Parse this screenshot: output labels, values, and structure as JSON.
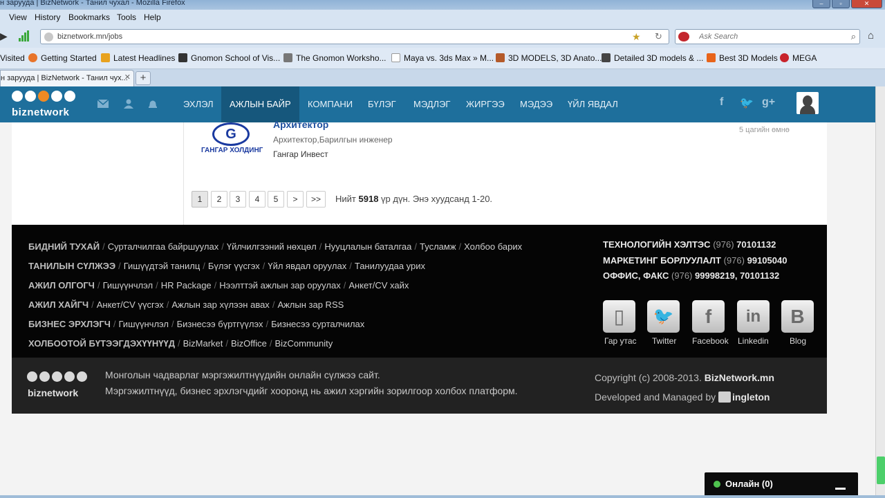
{
  "browser": {
    "window_title": "н заруудa | BizNetwork - Танил чухал - Mozilla Firefox",
    "menu": [
      "View",
      "History",
      "Bookmarks",
      "Tools",
      "Help"
    ],
    "url": "biznetwork.mn/jobs",
    "search_placeholder": "Ask Search",
    "bookmarks": [
      {
        "label": "Visited",
        "color": "#ffffff"
      },
      {
        "label": "Getting Started",
        "color": "#e8742a"
      },
      {
        "label": "Latest Headlines",
        "color": "#e8a21f"
      },
      {
        "label": "Gnomon School of Vis...",
        "color": "#333333"
      },
      {
        "label": "The Gnomon Worksho...",
        "color": "#555555"
      },
      {
        "label": "Maya vs. 3ds Max » M...",
        "color": "#dddddd"
      },
      {
        "label": "3D MODELS, 3D Anato...",
        "color": "#b45a2a"
      },
      {
        "label": "Detailed 3D models & ...",
        "color": "#444444"
      },
      {
        "label": "Best 3D Models",
        "color": "#e8641a"
      },
      {
        "label": "MEGA",
        "color": "#c8232b"
      }
    ],
    "tab_title": "н заруудa | BizNetwork - Танил чух..."
  },
  "header": {
    "logo_text": "biznetwork",
    "nav": [
      "ЭХЛЭЛ",
      "АЖЛЫН БАЙР",
      "КОМПАНИ",
      "БҮЛЭГ",
      "МЭДЛЭГ",
      "ЖИРГЭЭ",
      "МЭДЭЭ",
      "ҮЙЛ ЯВДАЛ"
    ],
    "active_nav": "АЖЛЫН БАЙР",
    "accent": "#1e6f9c"
  },
  "job": {
    "company_logo_text": "ГАНГАР ХОЛДИНГ",
    "title": "Архитектор",
    "category": "Архитектор,Барилгын инженер",
    "company": "Гангар Инвест",
    "posted": "5 цагийн өмнө"
  },
  "pagination": {
    "pages": [
      "1",
      "2",
      "3",
      "4",
      "5",
      ">",
      ">>"
    ],
    "current": "1",
    "summary_prefix": "Нийт",
    "total": "5918",
    "summary_suffix": "үр дүн. Энэ хуудсанд 1-20."
  },
  "footer": {
    "rows": [
      {
        "head": "БИДНИЙ ТУХАЙ",
        "links": [
          "Сурталчилгаа байршуулах",
          "Үйлчилгээний нөхцөл",
          "Нууцлалын баталгаа",
          "Тусламж",
          "Холбоо барих"
        ]
      },
      {
        "head": "ТАНИЛЫН СҮЛЖЭЭ",
        "links": [
          "Гишүүдтэй танилц",
          "Бүлэг үүсгэх",
          "Үйл явдал оруулах",
          "Танилуудаа урих"
        ]
      },
      {
        "head": "АЖИЛ ОЛГОГЧ",
        "links": [
          "Гишүүнчлэл",
          "HR Package",
          "Нээлттэй ажлын зар оруулах",
          "Анкет/CV хайх"
        ]
      },
      {
        "head": "АЖИЛ ХАЙГЧ",
        "links": [
          "Анкет/CV үүсгэх",
          "Ажлын зар хүлээн авах",
          "Ажлын зар RSS"
        ]
      },
      {
        "head": "БИЗНЕС ЭРХЛЭГЧ",
        "links": [
          "Гишүүнчлэл",
          "Бизнесээ бүртгүүлэх",
          "Бизнесээ сурталчилах"
        ]
      },
      {
        "head": "ХОЛБООТОЙ БҮТЭЭГДЭХҮҮНҮҮД",
        "links": [
          "BizMarket",
          "BizOffice",
          "BizCommunity"
        ]
      }
    ],
    "contacts": [
      {
        "label": "ТЕХНОЛОГИЙН ХЭЛТЭС",
        "code": "(976)",
        "number": "70101132"
      },
      {
        "label": "МАРКЕТИНГ БОРЛУУЛАЛТ",
        "code": "(976)",
        "number": "99105040"
      },
      {
        "label": "ОФФИС, ФАКС",
        "code": "(976)",
        "number": "99998219, 70101132"
      }
    ],
    "social": [
      {
        "label": "Гар утас",
        "icon": "mobile-icon",
        "glyph": "▯"
      },
      {
        "label": "Twitter",
        "icon": "twitter-icon",
        "glyph": "🐦"
      },
      {
        "label": "Facebook",
        "icon": "facebook-icon",
        "glyph": "f"
      },
      {
        "label": "Linkedin",
        "icon": "linkedin-icon",
        "glyph": "in"
      },
      {
        "label": "Blog",
        "icon": "blogger-icon",
        "glyph": "B"
      }
    ],
    "tagline1": "Монголын чадварлаг мэргэжилтнүүдийн онлайн сүлжээ сайт.",
    "tagline2": "Мэргэжилтнүүд, бизнес эрхлэгчдийг хооронд нь ажил хэргийн зорилгоор холбох платформ.",
    "copyright_prefix": "Copyright (c) 2008-2013.",
    "copyright_site": "BizNetwork.mn",
    "developed_by_prefix": "Developed and Managed by",
    "developer": "ingleton",
    "logo_text": "biznetwork"
  },
  "chat": {
    "label": "Онлайн (0)"
  }
}
